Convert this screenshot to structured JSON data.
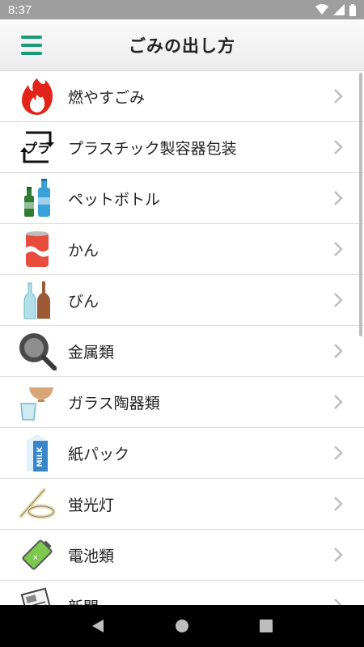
{
  "status": {
    "time": "8:37"
  },
  "header": {
    "title": "ごみの出し方"
  },
  "items": [
    {
      "label": "燃やすごみ",
      "icon": "flame-icon"
    },
    {
      "label": "プラスチック製容器包装",
      "icon": "plastic-recycle-icon"
    },
    {
      "label": "ペットボトル",
      "icon": "pet-bottle-icon"
    },
    {
      "label": "かん",
      "icon": "can-icon"
    },
    {
      "label": "びん",
      "icon": "glass-bottle-icon"
    },
    {
      "label": "金属類",
      "icon": "frying-pan-icon"
    },
    {
      "label": "ガラス陶器類",
      "icon": "bowl-cup-icon"
    },
    {
      "label": "紙パック",
      "icon": "milk-carton-icon"
    },
    {
      "label": "蛍光灯",
      "icon": "fluorescent-lamp-icon"
    },
    {
      "label": "電池類",
      "icon": "battery-icon"
    },
    {
      "label": "新聞",
      "icon": "newspaper-icon"
    }
  ],
  "colors": {
    "accent": "#1a9a76",
    "statusbar": "#9e9e9e",
    "navbar": "#000000"
  }
}
